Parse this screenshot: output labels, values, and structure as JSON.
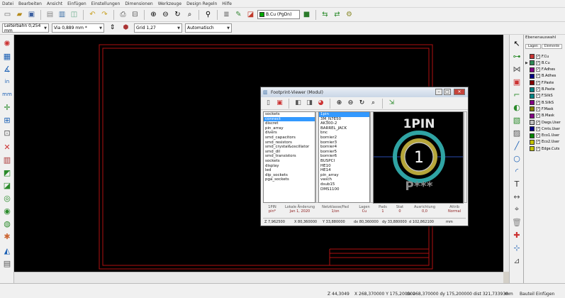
{
  "menu": [
    "Datei",
    "Bearbeiten",
    "Ansicht",
    "Einfügen",
    "Einstellungen",
    "Dimensionen",
    "Werkzeuge",
    "Design Regeln",
    "Hilfe"
  ],
  "toolbar": {
    "layer_select": "B.Cu (PgDn)",
    "layer_swatch_color": "#00aa00",
    "track_width": "Leiterbahn 0,254 mm",
    "via_size": "Via 0,889 mm *",
    "grid": "Grid 1,27",
    "zoom": "Automatisch"
  },
  "layers_manager": {
    "title": "Ebenenauswahl",
    "tabs": [
      "Lagen",
      "Elemente"
    ],
    "layers": [
      {
        "name": "F.Cu",
        "color": "#c83434",
        "checked": true
      },
      {
        "name": "B.Cu",
        "color": "#2e8b57",
        "checked": true
      },
      {
        "name": "F.Adhes",
        "color": "#840084",
        "checked": true
      },
      {
        "name": "B.Adhes",
        "color": "#000084",
        "checked": true
      },
      {
        "name": "F.Paste",
        "color": "#840000",
        "checked": true
      },
      {
        "name": "B.Paste",
        "color": "#008484",
        "checked": true
      },
      {
        "name": "F.SilkS",
        "color": "#008484",
        "checked": true
      },
      {
        "name": "B.SilkS",
        "color": "#840084",
        "checked": true
      },
      {
        "name": "F.Mask",
        "color": "#848400",
        "checked": true
      },
      {
        "name": "B.Mask",
        "color": "#840084",
        "checked": true
      },
      {
        "name": "Dwgs.User",
        "color": "#c2c2c2",
        "checked": true
      },
      {
        "name": "Cmts.User",
        "color": "#000084",
        "checked": true
      },
      {
        "name": "Eco1.User",
        "color": "#008400",
        "checked": true
      },
      {
        "name": "Eco2.User",
        "color": "#c2c200",
        "checked": true
      },
      {
        "name": "Edge.Cuts",
        "color": "#c2c200",
        "checked": true
      }
    ]
  },
  "footprint_viewer": {
    "title": "Footprint-Viewer (Modul)",
    "libraries": [
      "sockets",
      "connect",
      "discret",
      "pin_array",
      "divers",
      "smd_capacitors",
      "smd_resistors",
      "smd_crystal&oscillator",
      "smd_dil",
      "smd_transistors",
      "sockets",
      "display",
      "led",
      "dip_sockets",
      "pga_sockets"
    ],
    "selected_library_index": 1,
    "footprints": [
      "1pin",
      "3M_N7E50",
      "AK300-2",
      "BARREL_JACK",
      "bnc",
      "bornier2",
      "bornier3",
      "bornier4",
      "bornier5",
      "bornier6",
      "BUSPCI",
      "HE10",
      "HE14",
      "pin_array",
      "vasch",
      "dsub15",
      "DMS1100"
    ],
    "selected_footprint_index": 0,
    "preview": {
      "text_top": "1PIN",
      "pad_number": "1",
      "text_bottom": "P***"
    },
    "info": [
      {
        "label": "1PIN",
        "value": "pin*"
      },
      {
        "label": "Lokale Änderung",
        "value": "Jan 1, 2020"
      },
      {
        "label": "Netzklasse/Pad",
        "value": "1/on"
      },
      {
        "label": "Lagen",
        "value": "Cu"
      },
      {
        "label": "Pads",
        "value": "1"
      },
      {
        "label": "Stat",
        "value": "0"
      },
      {
        "label": "Ausrichtung",
        "value": "0,0"
      },
      {
        "label": "Attrib",
        "value": "Normal"
      }
    ],
    "status": {
      "z": "Z 7,962500",
      "x": "X 80,360000",
      "y": "Y 33,880000",
      "dx": "dx 80,360000",
      "dy": "dy 33,880000",
      "dist": "d 102,862100",
      "unit": "mm"
    }
  },
  "status": {
    "zoom": "Z 44,3049",
    "coords": "X 268,370000  Y 175,200000",
    "delta": "dx 268,370000  dy 175,200000  dist 321,733930",
    "unit": "mm",
    "mode": "Bauteil Einfügen"
  }
}
